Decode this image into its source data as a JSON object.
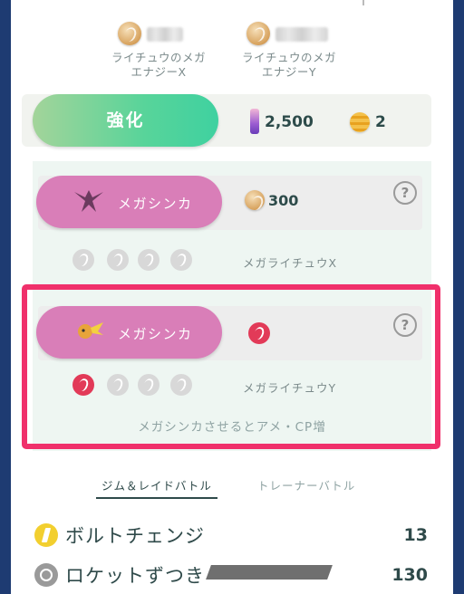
{
  "mega_energy": {
    "x": {
      "label_line1": "ライチュウのメガ",
      "label_line2": "エナジーX"
    },
    "y": {
      "label_line1": "ライチュウのメガ",
      "label_line2": "エナジーY"
    }
  },
  "power_up": {
    "label": "強化",
    "stardust_cost": "2,500",
    "candy_cost": "2"
  },
  "mega_evolve": [
    {
      "button_label": "メガシンカ",
      "cost": "300",
      "form_name": "メガライチュウX",
      "levels_filled": 0,
      "levels_total": 4
    },
    {
      "button_label": "メガシンカ",
      "cost": "",
      "form_name": "メガライチュウY",
      "levels_filled": 1,
      "levels_total": 4
    }
  ],
  "help_label": "?",
  "footnote": "メガシンカさせるとアメ・CP増",
  "tabs": [
    {
      "label": "ジム＆レイドバトル",
      "active": true
    },
    {
      "label": "トレーナーバトル",
      "active": false
    }
  ],
  "moves": [
    {
      "name": "ボルトチェンジ",
      "power": "13",
      "type": "electric"
    },
    {
      "name": "ロケットずつき",
      "power": "130",
      "type": "normal"
    }
  ],
  "colors": {
    "background": "#1e3b72",
    "power_up_green": "#3fd1a0",
    "mega_pink": "#d97eb8",
    "highlight": "#f0306b"
  }
}
